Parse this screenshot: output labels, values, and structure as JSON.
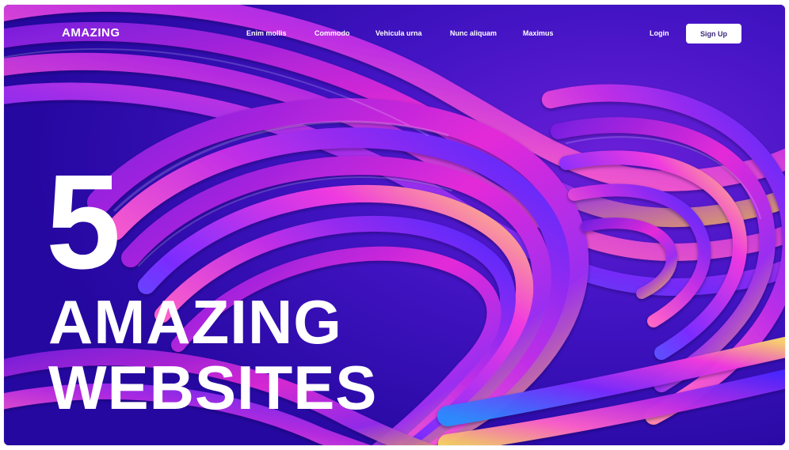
{
  "brand": {
    "logo_text": "AMAZING"
  },
  "nav": {
    "items": [
      {
        "label": "Enim mollis"
      },
      {
        "label": "Commodo"
      },
      {
        "label": "Vehicula urna"
      },
      {
        "label": "Nunc aliquam"
      },
      {
        "label": "Maximus"
      }
    ],
    "login_label": "Login",
    "signup_label": "Sign Up"
  },
  "hero": {
    "number": "5",
    "line1": "AMAZING",
    "line2": "WEBSITES"
  },
  "colors": {
    "background_deep": "#2a0fa8",
    "swirl_violet": "#8a2be2",
    "swirl_magenta": "#e02ad6",
    "swirl_blue": "#3b3cf0",
    "swirl_gold": "#f5c542",
    "text": "#ffffff",
    "button_text": "#3b2a7a"
  },
  "icons": {
    "hero_art": "abstract-swirl-art"
  }
}
